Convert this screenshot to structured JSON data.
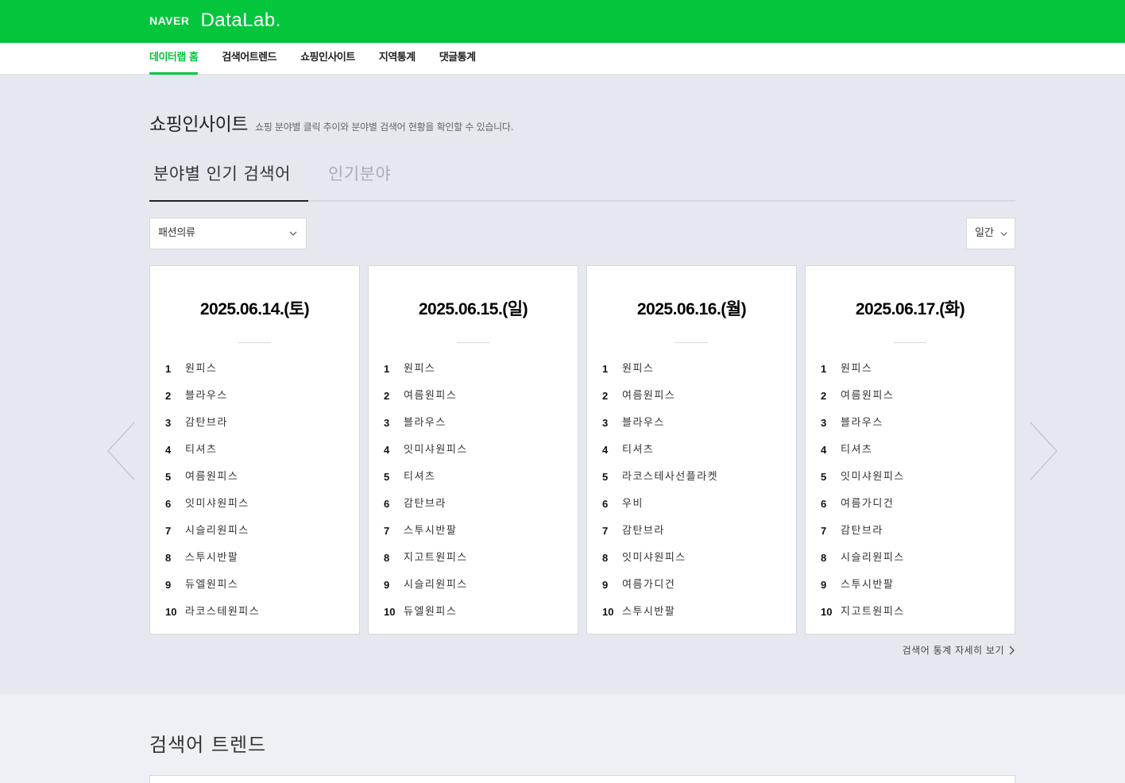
{
  "brand": {
    "naver": "NAVER",
    "datalab": "DataLab."
  },
  "gnb": [
    {
      "label": "데이터랩 홈",
      "active": true
    },
    {
      "label": "검색어트렌드",
      "active": false
    },
    {
      "label": "쇼핑인사이트",
      "active": false
    },
    {
      "label": "지역통계",
      "active": false
    },
    {
      "label": "댓글통계",
      "active": false
    }
  ],
  "section": {
    "title": "쇼핑인사이트",
    "description": "쇼핑 분야별 클릭 추이와 분야별 검색어 현황을 확인할 수 있습니다."
  },
  "tabs": [
    {
      "label": "분야별 인기 검색어",
      "active": true
    },
    {
      "label": "인기분야",
      "active": false
    }
  ],
  "category_select": {
    "value": "패션의류"
  },
  "period_select": {
    "value": "일간"
  },
  "cards": [
    {
      "date": "2025.06.14.(토)",
      "ranks": [
        {
          "num": "1",
          "keyword": "원피스"
        },
        {
          "num": "2",
          "keyword": "블라우스"
        },
        {
          "num": "3",
          "keyword": "감탄브라"
        },
        {
          "num": "4",
          "keyword": "티셔츠"
        },
        {
          "num": "5",
          "keyword": "여름원피스"
        },
        {
          "num": "6",
          "keyword": "잇미샤원피스"
        },
        {
          "num": "7",
          "keyword": "시슬리원피스"
        },
        {
          "num": "8",
          "keyword": "스투시반팔"
        },
        {
          "num": "9",
          "keyword": "듀엘원피스"
        },
        {
          "num": "10",
          "keyword": "라코스테원피스"
        }
      ]
    },
    {
      "date": "2025.06.15.(일)",
      "ranks": [
        {
          "num": "1",
          "keyword": "원피스"
        },
        {
          "num": "2",
          "keyword": "여름원피스"
        },
        {
          "num": "3",
          "keyword": "블라우스"
        },
        {
          "num": "4",
          "keyword": "잇미샤원피스"
        },
        {
          "num": "5",
          "keyword": "티셔츠"
        },
        {
          "num": "6",
          "keyword": "감탄브라"
        },
        {
          "num": "7",
          "keyword": "스투시반팔"
        },
        {
          "num": "8",
          "keyword": "지고트원피스"
        },
        {
          "num": "9",
          "keyword": "시슬리원피스"
        },
        {
          "num": "10",
          "keyword": "듀엘원피스"
        }
      ]
    },
    {
      "date": "2025.06.16.(월)",
      "ranks": [
        {
          "num": "1",
          "keyword": "원피스"
        },
        {
          "num": "2",
          "keyword": "여름원피스"
        },
        {
          "num": "3",
          "keyword": "블라우스"
        },
        {
          "num": "4",
          "keyword": "티셔츠"
        },
        {
          "num": "5",
          "keyword": "라코스테사선플라켓"
        },
        {
          "num": "6",
          "keyword": "우비"
        },
        {
          "num": "7",
          "keyword": "감탄브라"
        },
        {
          "num": "8",
          "keyword": "잇미샤원피스"
        },
        {
          "num": "9",
          "keyword": "여름가디건"
        },
        {
          "num": "10",
          "keyword": "스투시반팔"
        }
      ]
    },
    {
      "date": "2025.06.17.(화)",
      "ranks": [
        {
          "num": "1",
          "keyword": "원피스"
        },
        {
          "num": "2",
          "keyword": "여름원피스"
        },
        {
          "num": "3",
          "keyword": "블라우스"
        },
        {
          "num": "4",
          "keyword": "티셔츠"
        },
        {
          "num": "5",
          "keyword": "잇미샤원피스"
        },
        {
          "num": "6",
          "keyword": "여름가디건"
        },
        {
          "num": "7",
          "keyword": "감탄브라"
        },
        {
          "num": "8",
          "keyword": "시슬리원피스"
        },
        {
          "num": "9",
          "keyword": "스투시반팔"
        },
        {
          "num": "10",
          "keyword": "지고트원피스"
        }
      ]
    }
  ],
  "more_link": "검색어 통계 자세히 보기",
  "lower_section": {
    "title": "검색어 트렌드"
  },
  "icons": {
    "prev": "chevron-left-icon",
    "next": "chevron-right-icon",
    "dropdown": "chevron-down-icon",
    "more": "chevron-right-small-icon"
  },
  "colors": {
    "brand_green": "#03c63c",
    "background": "#e5e9ef",
    "card_border": "#d3d8df"
  }
}
